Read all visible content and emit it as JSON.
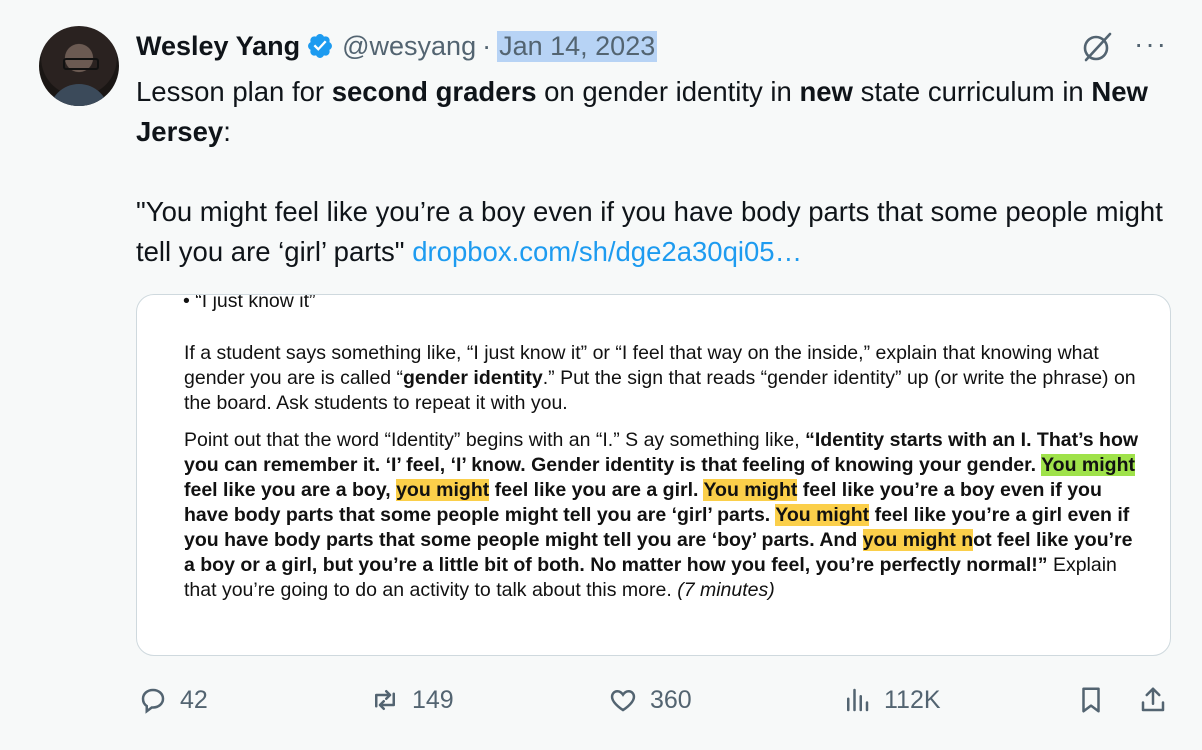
{
  "author": {
    "name": "Wesley Yang",
    "handle": "@wesyang",
    "separator": "·",
    "date": "Jan 14, 2023"
  },
  "tweet": {
    "line1_a": "Lesson plan for ",
    "line1_b": "second graders",
    "line1_c": " on gender identity in ",
    "line1_d": "new",
    "line1_e": " state curriculum in ",
    "line1_f": "New Jersey",
    "line1_g": ":",
    "quote": "\"You might feel like you’re a boy even if you have body parts that some people might tell you are ‘girl’ parts\" ",
    "link": "dropbox.com/sh/dge2a30qi05…"
  },
  "image": {
    "bullet": "•  “I just know it”",
    "p1_a": "If a student says something like, “I just know it” or “I feel that way on the inside,” explain that knowing what gender you are is called “",
    "p1_b": "gender identity",
    "p1_c": ".” Put the sign that reads “gender identity” up (or write the phrase) on the board. Ask students to repeat it with you.",
    "p2_a": "Point out that the word “Identity” begins with an “I.” S ay something like, ",
    "p2_b": "“Identity starts with an I. That’s how you can remember it. ‘I’ feel, ‘I’ know. Gender identity is that feeling of knowing your gender. ",
    "p2_hl1": "You might",
    "p2_c": " feel like you are a boy, ",
    "p2_hl2": "you might",
    "p2_d": " feel like you are a girl. ",
    "p2_hl3": "You might",
    "p2_e": " feel like you’re a boy even if you have body parts that some people might tell you are ‘girl’ parts. ",
    "p2_hl4": "You might",
    "p2_f": " feel like you’re a girl even if you have body parts that some people might tell you are ‘boy’ parts. And ",
    "p2_hl5": "you might n",
    "p2_g": "ot feel like you’re a boy or a girl, but you’re a little bit of both. No matter how you feel, you’re perfectly normal!”",
    "p2_h": " Explain that you’re going to do an activity to talk about this more. ",
    "p2_i": "(7 minutes)"
  },
  "actions": {
    "replies": "42",
    "reposts": "149",
    "likes": "360",
    "views": "112K"
  },
  "colors": {
    "link": "#1d9bf0",
    "verified": "#1d9bf0",
    "highlight_yellow": "#fbcf4a",
    "highlight_green": "#9fe24a"
  },
  "icons": [
    "verified-badge-icon",
    "grok-icon",
    "more-icon",
    "reply-icon",
    "repost-icon",
    "like-icon",
    "views-icon",
    "bookmark-icon",
    "share-icon"
  ]
}
